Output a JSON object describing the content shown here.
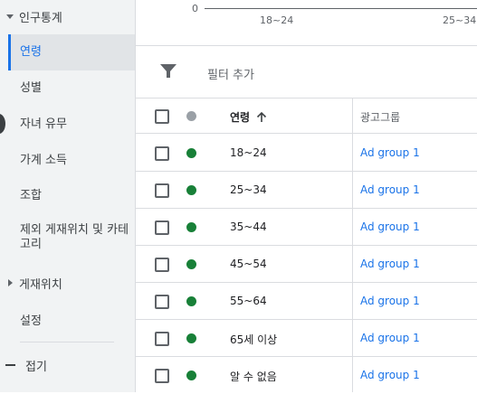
{
  "sidebar": {
    "section_demographics": "인구통계",
    "items": [
      {
        "label": "연령",
        "active": true
      },
      {
        "label": "성별"
      },
      {
        "label": "자녀 유무"
      },
      {
        "label": "가계 소득"
      },
      {
        "label": "조합"
      },
      {
        "label": "제외 게재위치 및 카테고리"
      }
    ],
    "section_placements": "게재위치",
    "settings": "설정",
    "collapse": "접기"
  },
  "axis": {
    "zero_label": "0",
    "ticks": [
      "18~24",
      "25~34"
    ]
  },
  "filter": {
    "label": "필터 추가",
    "icon": "filter-icon"
  },
  "table": {
    "header_age": "연령",
    "header_adgroup": "광고그룹",
    "status_color": "#188038",
    "rows": [
      {
        "age": "18~24",
        "ad_group": "Ad group 1"
      },
      {
        "age": "25~34",
        "ad_group": "Ad group 1"
      },
      {
        "age": "35~44",
        "ad_group": "Ad group 1"
      },
      {
        "age": "45~54",
        "ad_group": "Ad group 1"
      },
      {
        "age": "55~64",
        "ad_group": "Ad group 1"
      },
      {
        "age": "65세 이상",
        "ad_group": "Ad group 1"
      },
      {
        "age": "알 수 없음",
        "ad_group": "Ad group 1"
      }
    ]
  }
}
